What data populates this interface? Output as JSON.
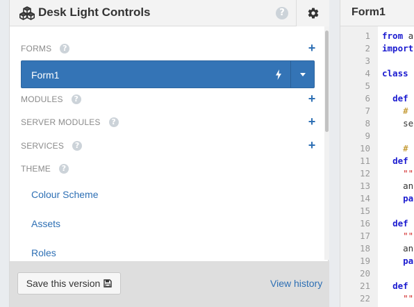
{
  "left_panel": {
    "title": "Desk Light Controls",
    "header_help_glyph": "?",
    "sections": {
      "forms": "FORMS",
      "modules": "MODULES",
      "server_modules": "SERVER MODULES",
      "services": "SERVICES",
      "theme": "THEME"
    },
    "plus_glyph": "+",
    "help_glyph": "?",
    "active_form": "Form1",
    "theme_items": [
      "Colour Scheme",
      "Assets",
      "Roles"
    ],
    "footer": {
      "save_label": "Save this version",
      "view_history_label": "View history"
    }
  },
  "right_panel": {
    "title": "Form1",
    "code_lines": [
      {
        "n": "1",
        "parts": [
          {
            "t": "from",
            "c": "kw"
          },
          {
            "t": " a",
            "c": "nm"
          }
        ]
      },
      {
        "n": "2",
        "parts": [
          {
            "t": "import",
            "c": "kw"
          }
        ]
      },
      {
        "n": "3",
        "parts": []
      },
      {
        "n": "4",
        "parts": [
          {
            "t": "class",
            "c": "kw"
          }
        ]
      },
      {
        "n": "5",
        "parts": []
      },
      {
        "n": "6",
        "parts": [
          {
            "t": "  ",
            "c": "nm"
          },
          {
            "t": "def",
            "c": "kw"
          }
        ]
      },
      {
        "n": "7",
        "parts": [
          {
            "t": "    ",
            "c": "nm"
          },
          {
            "t": "#",
            "c": "cm"
          }
        ]
      },
      {
        "n": "8",
        "parts": [
          {
            "t": "    se",
            "c": "nm"
          }
        ]
      },
      {
        "n": "9",
        "parts": []
      },
      {
        "n": "10",
        "parts": [
          {
            "t": "    ",
            "c": "nm"
          },
          {
            "t": "#",
            "c": "cm"
          }
        ]
      },
      {
        "n": "11",
        "parts": [
          {
            "t": "  ",
            "c": "nm"
          },
          {
            "t": "def",
            "c": "kw"
          }
        ]
      },
      {
        "n": "12",
        "parts": [
          {
            "t": "    ",
            "c": "nm"
          },
          {
            "t": "\"\"",
            "c": "st"
          }
        ]
      },
      {
        "n": "13",
        "parts": [
          {
            "t": "    an",
            "c": "nm"
          }
        ]
      },
      {
        "n": "14",
        "parts": [
          {
            "t": "    ",
            "c": "nm"
          },
          {
            "t": "pa",
            "c": "kw"
          }
        ]
      },
      {
        "n": "15",
        "parts": []
      },
      {
        "n": "16",
        "parts": [
          {
            "t": "  ",
            "c": "nm"
          },
          {
            "t": "def",
            "c": "kw"
          }
        ]
      },
      {
        "n": "17",
        "parts": [
          {
            "t": "    ",
            "c": "nm"
          },
          {
            "t": "\"\"",
            "c": "st"
          }
        ]
      },
      {
        "n": "18",
        "parts": [
          {
            "t": "    an",
            "c": "nm"
          }
        ]
      },
      {
        "n": "19",
        "parts": [
          {
            "t": "    ",
            "c": "nm"
          },
          {
            "t": "pa",
            "c": "kw"
          }
        ]
      },
      {
        "n": "20",
        "parts": []
      },
      {
        "n": "21",
        "parts": [
          {
            "t": "  ",
            "c": "nm"
          },
          {
            "t": "def",
            "c": "kw"
          }
        ]
      },
      {
        "n": "22",
        "parts": [
          {
            "t": "    ",
            "c": "nm"
          },
          {
            "t": "\"\"",
            "c": "st"
          }
        ]
      }
    ]
  },
  "colors": {
    "accent": "#3474b6",
    "link": "#2d6fb4",
    "keyword": "#1b1bd0",
    "comment": "#b8860b",
    "string": "#d02020"
  },
  "icons": {
    "app": "cubes-icon",
    "settings": "gear-icon",
    "help": "question-circle-icon",
    "add": "plus-icon",
    "startup": "bolt-icon",
    "dropdown": "caret-down-icon",
    "save": "floppy-disk-icon"
  }
}
